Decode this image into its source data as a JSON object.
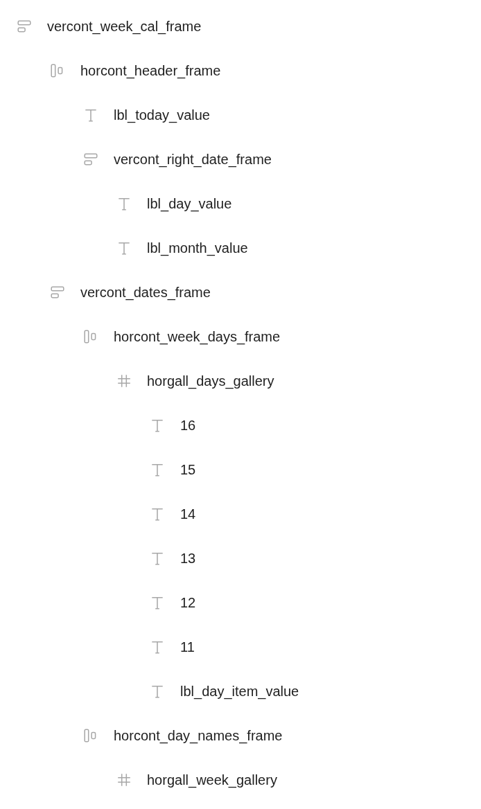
{
  "tree": [
    {
      "kind": "vertical",
      "label": "vercont_week_cal_frame",
      "children": [
        {
          "kind": "horizontal",
          "label": "horcont_header_frame",
          "children": [
            {
              "kind": "text",
              "label": "lbl_today_value"
            },
            {
              "kind": "vertical",
              "label": "vercont_right_date_frame",
              "children": [
                {
                  "kind": "text",
                  "label": "lbl_day_value"
                },
                {
                  "kind": "text",
                  "label": "lbl_month_value"
                }
              ]
            }
          ]
        },
        {
          "kind": "vertical",
          "label": "vercont_dates_frame",
          "children": [
            {
              "kind": "horizontal",
              "label": "horcont_week_days_frame",
              "children": [
                {
                  "kind": "gallery",
                  "label": "horgall_days_gallery",
                  "children": [
                    {
                      "kind": "text",
                      "label": "16"
                    },
                    {
                      "kind": "text",
                      "label": "15"
                    },
                    {
                      "kind": "text",
                      "label": "14"
                    },
                    {
                      "kind": "text",
                      "label": "13"
                    },
                    {
                      "kind": "text",
                      "label": "12"
                    },
                    {
                      "kind": "text",
                      "label": "11"
                    },
                    {
                      "kind": "text",
                      "label": "lbl_day_item_value"
                    }
                  ]
                }
              ]
            },
            {
              "kind": "horizontal",
              "label": "horcont_day_names_frame",
              "children": [
                {
                  "kind": "gallery",
                  "label": "horgall_week_gallery"
                }
              ]
            }
          ]
        }
      ]
    }
  ]
}
